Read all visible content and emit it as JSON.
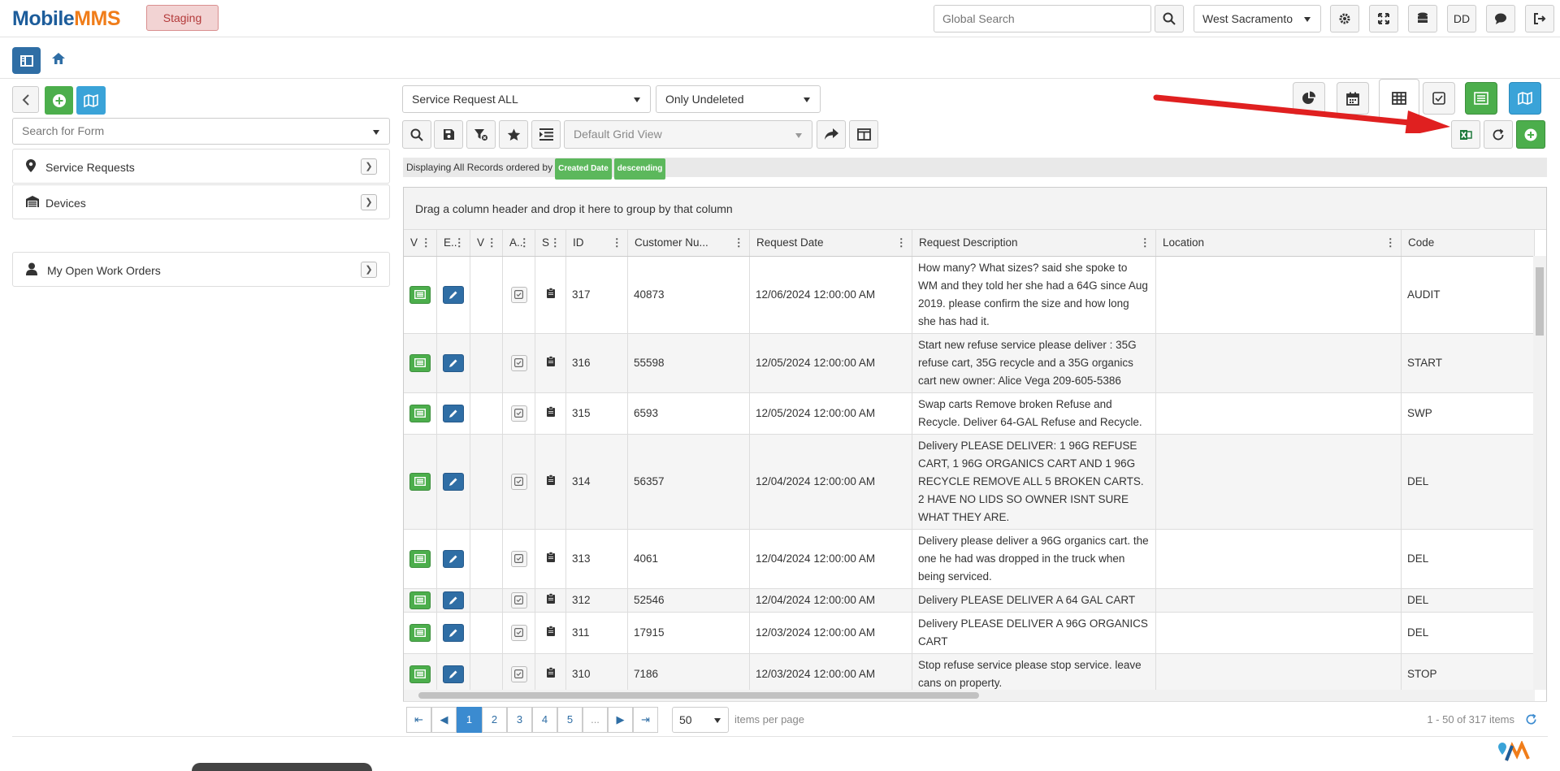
{
  "header": {
    "logo_part1": "Mobile",
    "logo_part2": "MMS",
    "env_label": "Staging",
    "search_placeholder": "Global Search",
    "location": "West Sacramento",
    "user_initials": "DD"
  },
  "sidebar": {
    "search_placeholder": "Search for Form",
    "items": [
      {
        "label": "Service Requests",
        "icon": "map-pin-icon"
      },
      {
        "label": "Devices",
        "icon": "garage-icon"
      },
      {
        "label": "My Open Work Orders",
        "icon": "person-icon"
      }
    ]
  },
  "filters": {
    "form_select": "Service Request ALL",
    "deleted_select": "Only Undeleted",
    "grid_view_placeholder": "Default Grid View"
  },
  "status": {
    "text": "Displaying All Records ordered by",
    "order_field": "Created Date",
    "order_dir": "descending"
  },
  "grid": {
    "group_hint": "Drag a column header and drop it here to group by that column",
    "columns": [
      "V",
      "E..",
      "V",
      "A..",
      "S",
      "ID",
      "Customer Nu...",
      "Request Date",
      "Request Description",
      "Location",
      "Code"
    ],
    "rows": [
      {
        "id": "317",
        "customer": "40873",
        "date": "12/06/2024 12:00:00 AM",
        "desc": "How many? What sizes? said she spoke to WM and they told her she had a 64G since Aug 2019. please confirm the size and how long she has had it.",
        "location": "",
        "code": "AUDIT"
      },
      {
        "id": "316",
        "customer": "55598",
        "date": "12/05/2024 12:00:00 AM",
        "desc": "Start new refuse service please deliver : 35G refuse cart, 35G recycle and a 35G organics cart new owner: Alice Vega 209-605-5386",
        "location": "",
        "code": "START"
      },
      {
        "id": "315",
        "customer": "6593",
        "date": "12/05/2024 12:00:00 AM",
        "desc": "Swap carts Remove broken Refuse and Recycle. Deliver 64-GAL Refuse and Recycle.",
        "location": "",
        "code": "SWP"
      },
      {
        "id": "314",
        "customer": "56357",
        "date": "12/04/2024 12:00:00 AM",
        "desc": "Delivery PLEASE DELIVER: 1 96G REFUSE CART, 1 96G ORGANICS CART AND 1 96G RECYCLE REMOVE ALL 5 BROKEN CARTS. 2 HAVE NO LIDS SO OWNER ISNT SURE WHAT THEY ARE.",
        "location": "",
        "code": "DEL"
      },
      {
        "id": "313",
        "customer": "4061",
        "date": "12/04/2024 12:00:00 AM",
        "desc": "Delivery please deliver a 96G organics cart. the one he had was dropped in the truck when being serviced.",
        "location": "",
        "code": "DEL"
      },
      {
        "id": "312",
        "customer": "52546",
        "date": "12/04/2024 12:00:00 AM",
        "desc": "Delivery PLEASE DELIVER A 64 GAL CART",
        "location": "",
        "code": "DEL"
      },
      {
        "id": "311",
        "customer": "17915",
        "date": "12/03/2024 12:00:00 AM",
        "desc": "Delivery PLEASE DELIVER A 96G ORGANICS CART",
        "location": "",
        "code": "DEL"
      },
      {
        "id": "310",
        "customer": "7186",
        "date": "12/03/2024 12:00:00 AM",
        "desc": "Stop refuse service please stop service. leave cans on property.",
        "location": "",
        "code": "STOP"
      }
    ]
  },
  "pager": {
    "pages": [
      "1",
      "2",
      "3",
      "4",
      "5",
      "..."
    ],
    "per_page": "50",
    "per_page_label": "items per page",
    "summary": "1 - 50 of 317 items"
  },
  "colors": {
    "primary": "#2f6ea5",
    "success": "#4cae4c",
    "accent_orange": "#f07d1a",
    "arrow": "#e02020"
  }
}
